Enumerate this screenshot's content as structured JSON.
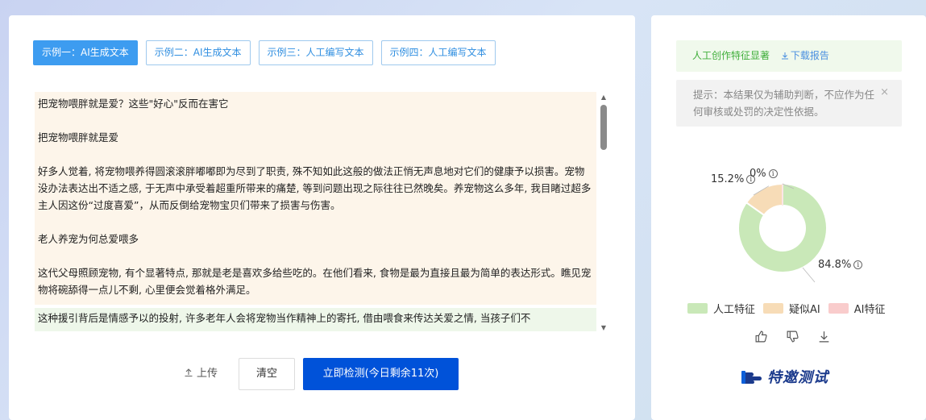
{
  "tabs": [
    {
      "label": "示例一：AI生成文本",
      "active": true
    },
    {
      "label": "示例二：AI生成文本",
      "active": false
    },
    {
      "label": "示例三：人工编写文本",
      "active": false
    },
    {
      "label": "示例四：人工编写文本",
      "active": false
    }
  ],
  "article": {
    "paragraphs": [
      "把宠物喂胖就是爱？这些\"好心\"反而在害它",
      "把宠物喂胖就是爱",
      "好多人觉着, 将宠物喂养得圆滚滚胖嘟嘟即为尽到了职责, 殊不知如此这般的做法正悄无声息地对它们的健康予以损害。宠物没办法表达出不适之感, 于无声中承受着超重所带来的痛楚, 等到问题出现之际往往已然晚矣。养宠物这么多年, 我目睹过超多主人因这份“过度喜爱”，从而反倒给宠物宝贝们带来了损害与伤害。",
      "老人养宠为何总爱喂多",
      "这代父母照顾宠物, 有个显著特点, 那就是老是喜欢多给些吃的。在他们看来, 食物是最为直接且最为简单的表达形式。瞧见宠物将碗舔得一点儿不剩, 心里便会觉着格外满足。"
    ],
    "next_paragraph": "这种援引背后是情感予以的投射, 许多老年人会将宠物当作精神上的寄托, 借由喂食来传达关爱之情, 当孩子们不"
  },
  "actions": {
    "upload_label": "上传",
    "clear_label": "清空",
    "detect_label": "立即检测(今日剩余11次)"
  },
  "result": {
    "title": "人工创作特征显著",
    "download_label": "下载报告",
    "notice": "提示：本结果仅为辅助判断，不应作为任何审核或处罚的决定性依据。",
    "close_glyph": "×"
  },
  "chart_data": {
    "type": "pie",
    "labels": [
      "人工特征",
      "疑似AI",
      "AI特征"
    ],
    "values": [
      84.8,
      15.2,
      0
    ],
    "value_labels": [
      "84.8%",
      "15.2%",
      "0%"
    ],
    "colors": [
      "#c9e8b8",
      "#f7dcb7",
      "#f9cccc"
    ],
    "legend_position": "bottom"
  },
  "branding": {
    "invite_label": "特邀测试"
  }
}
